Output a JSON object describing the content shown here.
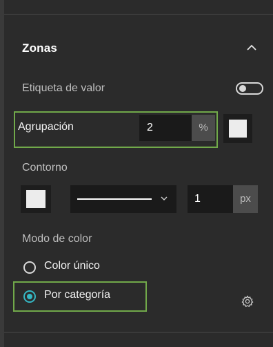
{
  "section": {
    "title": "Zonas"
  },
  "value_label": {
    "label": "Etiqueta de valor",
    "enabled": false
  },
  "grouping": {
    "label": "Agrupación",
    "value": "2",
    "unit": "%"
  },
  "outline": {
    "label": "Contorno",
    "width_value": "1",
    "width_unit": "px"
  },
  "color_mode": {
    "label": "Modo de color",
    "options": [
      {
        "label": "Color único",
        "selected": false
      },
      {
        "label": "Por categoría",
        "selected": true
      }
    ]
  },
  "icons": [
    "chevron-up-icon",
    "chevron-down-icon",
    "gear-icon"
  ],
  "colors": {
    "accent": "#35b7c4",
    "highlight": "#71a94a",
    "swatch": "#ececec"
  }
}
